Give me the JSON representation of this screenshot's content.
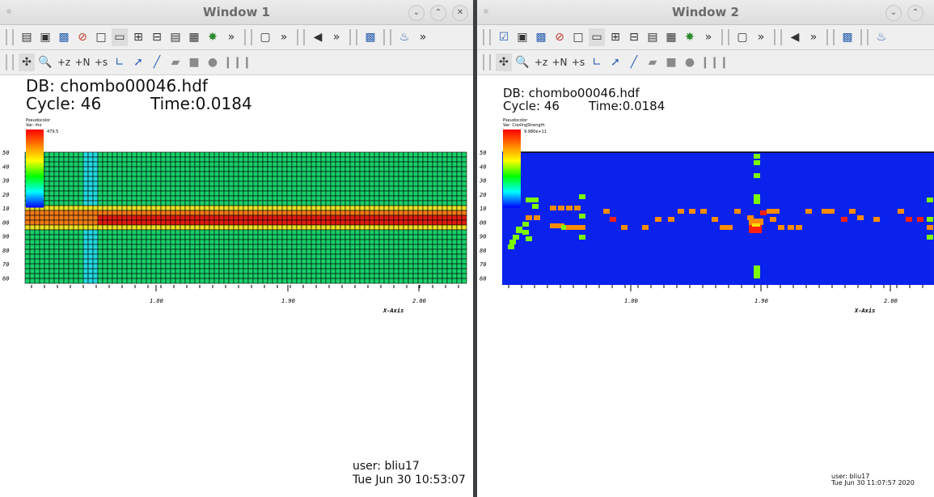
{
  "windows": [
    {
      "title": "Window 1",
      "db": "DB: chombo00046.hdf",
      "cycle": "Cycle: 46",
      "time": "Time:0.0184",
      "plot_type": "Pseudocolor",
      "var": "Var: rho",
      "max_label": "479.5",
      "xaxis_label": "X-Axis",
      "xticks": [
        "1.80",
        "1.90",
        "2.00"
      ],
      "yticks": [
        "50",
        "40",
        "30",
        "20",
        "10",
        "00",
        "90",
        "80",
        "70",
        "60"
      ],
      "user": "user: bliu17",
      "date": "Tue Jun 30 10:53:07"
    },
    {
      "title": "Window 2",
      "db": "DB: chombo00046.hdf",
      "cycle": "Cycle: 46",
      "time": "Time:0.0184",
      "plot_type": "Pseudocolor",
      "var": "Var: CoolingStrength",
      "max_label": "9.980e+11",
      "xaxis_label": "X-Axis",
      "xticks": [
        "1.80",
        "1.90",
        "2.00"
      ],
      "yticks": [
        "50",
        "40",
        "30",
        "20",
        "10",
        "00",
        "90",
        "80",
        "70",
        "60"
      ],
      "user": "user: bliu17",
      "date": "Tue Jun 30 11:07:57 2020"
    }
  ],
  "toolbar1": [
    "window-icon",
    "new-window-icon",
    "copy-window-icon",
    "delete-window-icon",
    "layout-1x1-icon",
    "layout-1x2-icon",
    "layout-2x2-icon",
    "layout-2x3-icon",
    "layout-3x3-icon",
    "layout-4x4-icon",
    "lock-view-icon",
    "more-icon",
    "3d-view-icon",
    "more-icon",
    "prev-frame-icon",
    "more-icon",
    "plot-icon",
    "more-icon",
    "python-icon"
  ],
  "toolbar2": [
    "navigate-icon",
    "zoom-icon",
    "lineout-z-icon",
    "lineout-n-icon",
    "lineout-s-icon",
    "curve-icon",
    "pick-icon",
    "line-icon",
    "box-tool-icon",
    "cube-tool-icon",
    "sphere-tool-icon",
    "sliders-icon"
  ],
  "colors": {
    "titlebar": "#e4e4e4",
    "toolbar": "#efefef",
    "cell_green": "#19d06a",
    "cell_cyan": "#22d8e0",
    "cell_yellow": "#e8e020",
    "cell_orange": "#f07a18",
    "cell_red": "#e01c10",
    "blue_bg": "#0a22ec",
    "grid_line": "#000000"
  }
}
